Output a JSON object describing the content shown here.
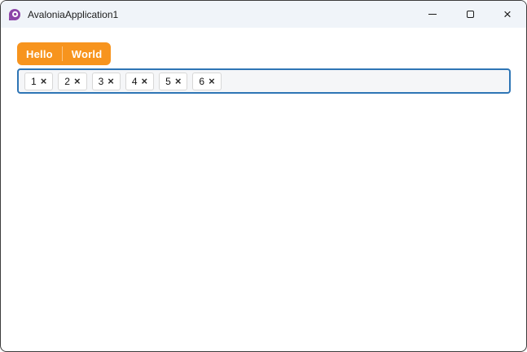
{
  "titlebar": {
    "app_icon": "avalonia-logo",
    "title": "AvaloniaApplication1",
    "minimize_icon": "minimize-icon",
    "maximize_icon": "maximize-icon",
    "close_icon": "close-icon",
    "close_glyph": "×"
  },
  "tabstrip": {
    "tabs": [
      {
        "label": "Hello",
        "selected": true
      },
      {
        "label": "World",
        "selected": false
      }
    ]
  },
  "tag_input": {
    "chips": [
      {
        "label": "1"
      },
      {
        "label": "2"
      },
      {
        "label": "3"
      },
      {
        "label": "4"
      },
      {
        "label": "5"
      },
      {
        "label": "6"
      }
    ],
    "remove_glyph": "×"
  },
  "colors": {
    "tab_orange": "#f7941e",
    "input_border_blue": "#2e75b5",
    "logo_purple": "#8c44a8",
    "titlebar_background": "#f0f4f9",
    "window_border": "#3d3d3d"
  }
}
